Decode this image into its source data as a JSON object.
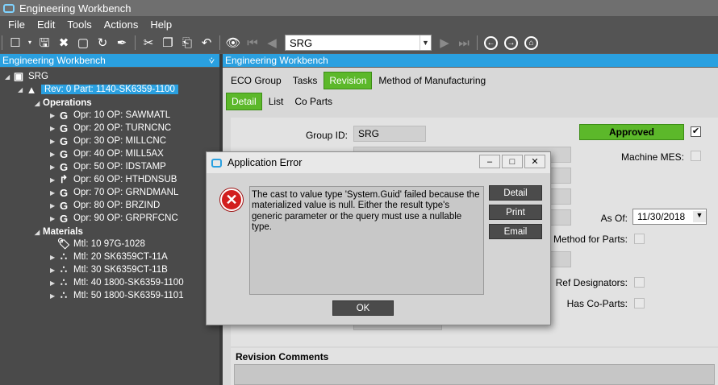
{
  "window": {
    "title": "Engineering Workbench"
  },
  "menu": [
    "File",
    "Edit",
    "Tools",
    "Actions",
    "Help"
  ],
  "toolbar": {
    "combo_value": "SRG"
  },
  "left_panel": {
    "title": "Engineering Workbench",
    "pin": "⩒",
    "root": "SRG",
    "revision": "Rev: 0 Part: 1140-SK6359-1100",
    "operations_label": "Operations",
    "operations": [
      "Opr: 10 OP: SAWMATL",
      "Opr: 20 OP: TURNCNC",
      "Opr: 30 OP: MILLCNC",
      "Opr: 40 OP: MILL5AX",
      "Opr: 50 OP: IDSTAMP",
      "Opr: 60 OP: HTHDNSUB",
      "Opr: 70 OP: GRNDMANL",
      "Opr: 80 OP: BRZIND",
      "Opr: 90 OP: GRPRFCNC"
    ],
    "materials_label": "Materials",
    "materials": [
      "Mtl: 10 97G-1028",
      "Mtl: 20 SK6359CT-11A",
      "Mtl: 30 SK6359CT-11B",
      "Mtl: 40 1800-SK6359-1100",
      "Mtl: 50 1800-SK6359-1101"
    ]
  },
  "right_panel": {
    "title": "Engineering Workbench",
    "tabs": [
      "ECO Group",
      "Tasks",
      "Revision",
      "Method of Manufacturing"
    ],
    "active_tab": "Revision",
    "subtabs": [
      "Detail",
      "List",
      "Co Parts"
    ],
    "active_subtab": "Detail",
    "form": {
      "group_id_label": "Group ID:",
      "group_id_value": "SRG",
      "status": "Approved",
      "machine_mes_label": "Machine MES:",
      "as_of_label": "As Of:",
      "as_of_value": "11/30/2018",
      "method_for_parts_label": "Method for Parts:",
      "ref_designators_label": "Ref Designators:",
      "has_co_parts_label": "Has Co-Parts:"
    },
    "comments_label": "Revision Comments"
  },
  "dialog": {
    "title": "Application Error",
    "message": "The cast to value type 'System.Guid' failed because the materialized value is null. Either the result type's generic parameter or the query must use a nullable type.",
    "buttons": {
      "detail": "Detail",
      "print": "Print",
      "email": "Email",
      "ok": "OK"
    }
  }
}
